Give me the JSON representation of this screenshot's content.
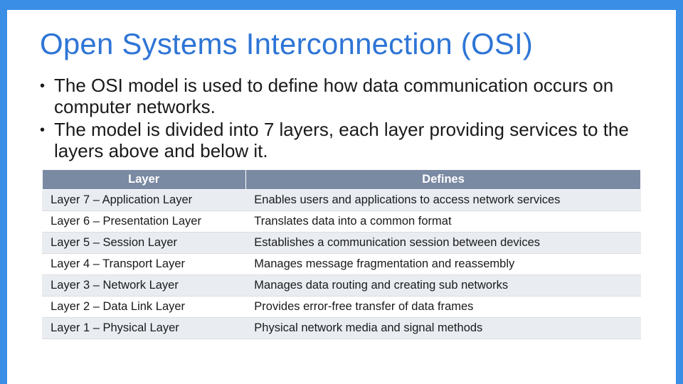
{
  "title": "Open Systems Interconnection (OSI)",
  "bullets": [
    "The OSI model is used to define how data communication occurs on computer networks.",
    "The model is divided into 7 layers, each layer providing services to the layers above and below it."
  ],
  "table": {
    "headers": {
      "layer": "Layer",
      "defines": "Defines"
    },
    "rows": [
      {
        "layer": "Layer 7 – Application Layer",
        "defines": "Enables users and applications to access network services"
      },
      {
        "layer": "Layer 6 – Presentation Layer",
        "defines": "Translates data into a common format"
      },
      {
        "layer": "Layer 5 – Session Layer",
        "defines": "Establishes a communication session between devices"
      },
      {
        "layer": "Layer 4 – Transport Layer",
        "defines": "Manages message fragmentation and reassembly"
      },
      {
        "layer": "Layer 3 – Network Layer",
        "defines": "Manages data routing and creating sub networks"
      },
      {
        "layer": "Layer 2 – Data Link Layer",
        "defines": "Provides error-free transfer of data frames"
      },
      {
        "layer": "Layer 1 – Physical Layer",
        "defines": "Physical network media and signal methods"
      }
    ]
  }
}
